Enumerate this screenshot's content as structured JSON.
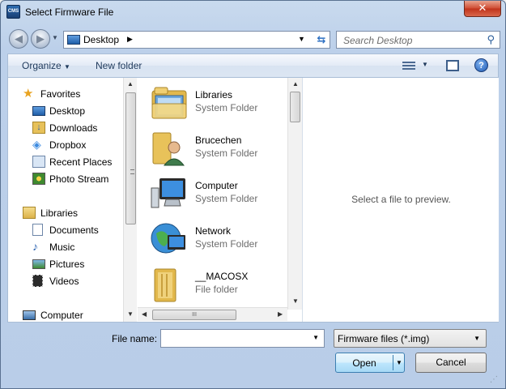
{
  "window": {
    "title": "Select Firmware File",
    "app_icon_text": "CMS",
    "close_glyph": "✕"
  },
  "address_bar": {
    "location": "Desktop",
    "search_placeholder": "Search Desktop"
  },
  "toolbar": {
    "organize_label": "Organize",
    "new_folder_label": "New folder"
  },
  "nav_pane": {
    "items": [
      {
        "label": "Favorites",
        "icon": "star-icon"
      },
      {
        "label": "Desktop",
        "icon": "desktop-icon"
      },
      {
        "label": "Downloads",
        "icon": "downloads-icon"
      },
      {
        "label": "Dropbox",
        "icon": "dropbox-icon"
      },
      {
        "label": "Recent Places",
        "icon": "recent-places-icon"
      },
      {
        "label": "Photo Stream",
        "icon": "photo-stream-icon"
      },
      {
        "label": "Libraries",
        "icon": "libraries-icon"
      },
      {
        "label": "Documents",
        "icon": "documents-icon"
      },
      {
        "label": "Music",
        "icon": "music-icon"
      },
      {
        "label": "Pictures",
        "icon": "pictures-icon"
      },
      {
        "label": "Videos",
        "icon": "videos-icon"
      },
      {
        "label": "Computer",
        "icon": "computer-icon"
      }
    ]
  },
  "files": [
    {
      "name": "Libraries",
      "type": "System Folder",
      "icon": "libraries-folder-icon"
    },
    {
      "name": "Brucechen",
      "type": "System Folder",
      "icon": "user-folder-icon"
    },
    {
      "name": "Computer",
      "type": "System Folder",
      "icon": "computer-icon"
    },
    {
      "name": "Network",
      "type": "System Folder",
      "icon": "network-icon"
    },
    {
      "name": "__MACOSX",
      "type": "File folder",
      "icon": "folder-icon"
    }
  ],
  "preview": {
    "message": "Select a file to preview."
  },
  "footer": {
    "file_name_label": "File name:",
    "file_name_value": "",
    "filter_value": "Firmware files (*.img)",
    "open_label": "Open",
    "cancel_label": "Cancel"
  }
}
